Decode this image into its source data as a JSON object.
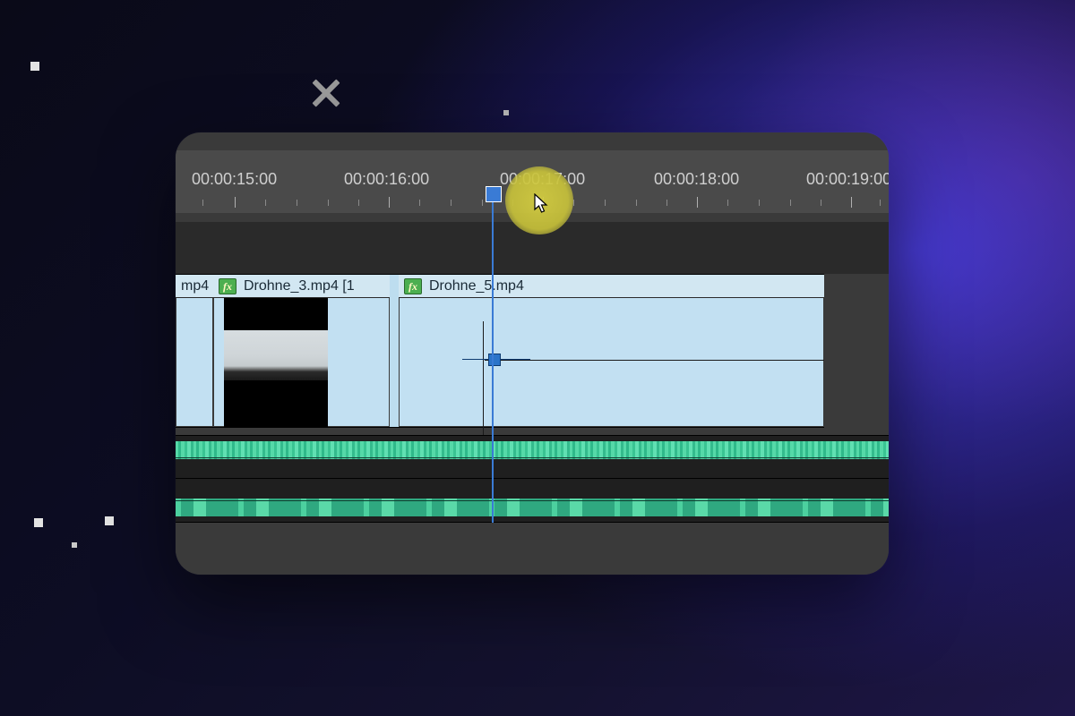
{
  "ruler": {
    "timecodes": [
      "00:00:15:00",
      "00:00:16:00",
      "00:00:17:00",
      "00:00:18:00",
      "00:00:19:00"
    ]
  },
  "clips": {
    "c1_label": "mp4",
    "c2_label": "Drohne_3.mp4 [1",
    "c3_label": "Drohne_5.mp4"
  },
  "fx_badge": "fx",
  "colors": {
    "workarea": "#f2e647",
    "playhead": "#3a7bd5",
    "clip_bg": "#c2e0f2",
    "waveform": "#55d9a8"
  }
}
